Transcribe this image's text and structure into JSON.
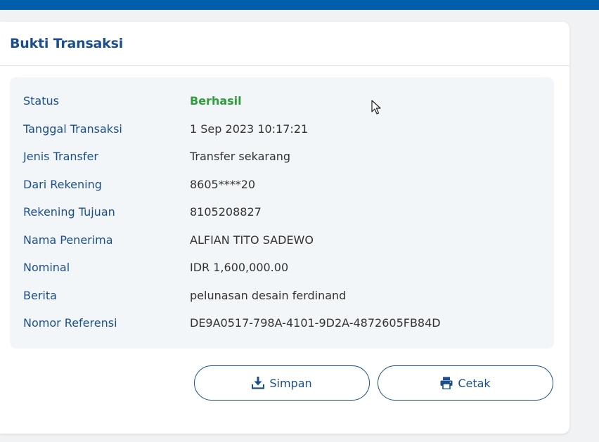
{
  "card": {
    "title": "Bukti Transaksi"
  },
  "details": [
    {
      "label": "Status",
      "value": "Berhasil",
      "status": true
    },
    {
      "label": "Tanggal Transaksi",
      "value": "1 Sep 2023 10:17:21"
    },
    {
      "label": "Jenis Transfer",
      "value": "Transfer sekarang"
    },
    {
      "label": "Dari Rekening",
      "value": "8605****20"
    },
    {
      "label": "Rekening Tujuan",
      "value": "8105208827"
    },
    {
      "label": "Nama Penerima",
      "value": "ALFIAN TITO SADEWO"
    },
    {
      "label": "Nominal",
      "value": "IDR 1,600,000.00"
    },
    {
      "label": "Berita",
      "value": "pelunasan desain ferdinand"
    },
    {
      "label": "Nomor Referensi",
      "value": "DE9A0517-798A-4101-9D2A-4872605FB84D"
    }
  ],
  "actions": {
    "save_label": "Simpan",
    "save_icon": "download-icon",
    "print_label": "Cetak",
    "print_icon": "printer-icon"
  },
  "colors": {
    "brand_blue": "#005eac",
    "label_blue": "#1a4f8b",
    "success_green": "#2e9e3b"
  }
}
